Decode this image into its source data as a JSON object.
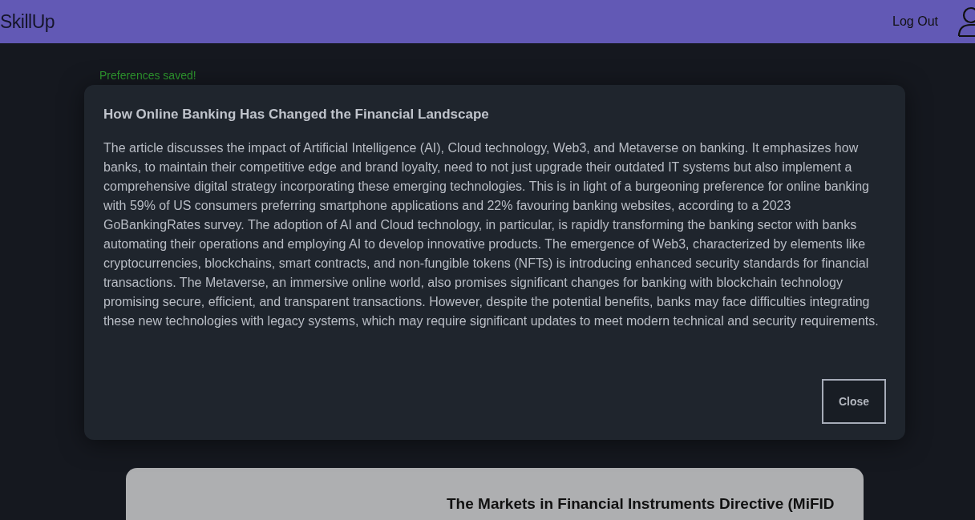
{
  "header": {
    "brand": "SkillUp",
    "logout": "Log Out"
  },
  "notice": "Preferences saved!",
  "modal": {
    "title": "How Online Banking Has Changed the Financial Landscape",
    "body": "The article discusses the impact of Artificial Intelligence (AI), Cloud technology, Web3, and Metaverse on banking. It emphasizes how banks, to maintain their competitive edge and brand loyalty, need to not just upgrade their outdated IT systems but also implement a comprehensive digital strategy incorporating these emerging technologies. This is in light of a burgeoning preference for online banking with 59% of US consumers preferring smartphone applications and 22% favouring banking websites, according to a 2023 GoBankingRates survey. The adoption of AI and Cloud technology, in particular, is rapidly transforming the banking sector with banks automating their operations and employing AI to develop innovative products. The emergence of Web3, characterized by elements like cryptocurrencies, blockchains, smart contracts, and non-fungible tokens (NFTs) is introducing enhanced security standards for financial transactions. The Metaverse, an immersive online world, also promises significant changes for banking with blockchain technology promising secure, efficient, and transparent transactions. However, despite the potential benefits, banks may face difficulties integrating these new technologies with legacy systems, which may require significant updates to meet modern technical and security requirements.",
    "close": "Close"
  },
  "card": {
    "title": "The Markets in Financial Instruments Directive (MiFID"
  }
}
